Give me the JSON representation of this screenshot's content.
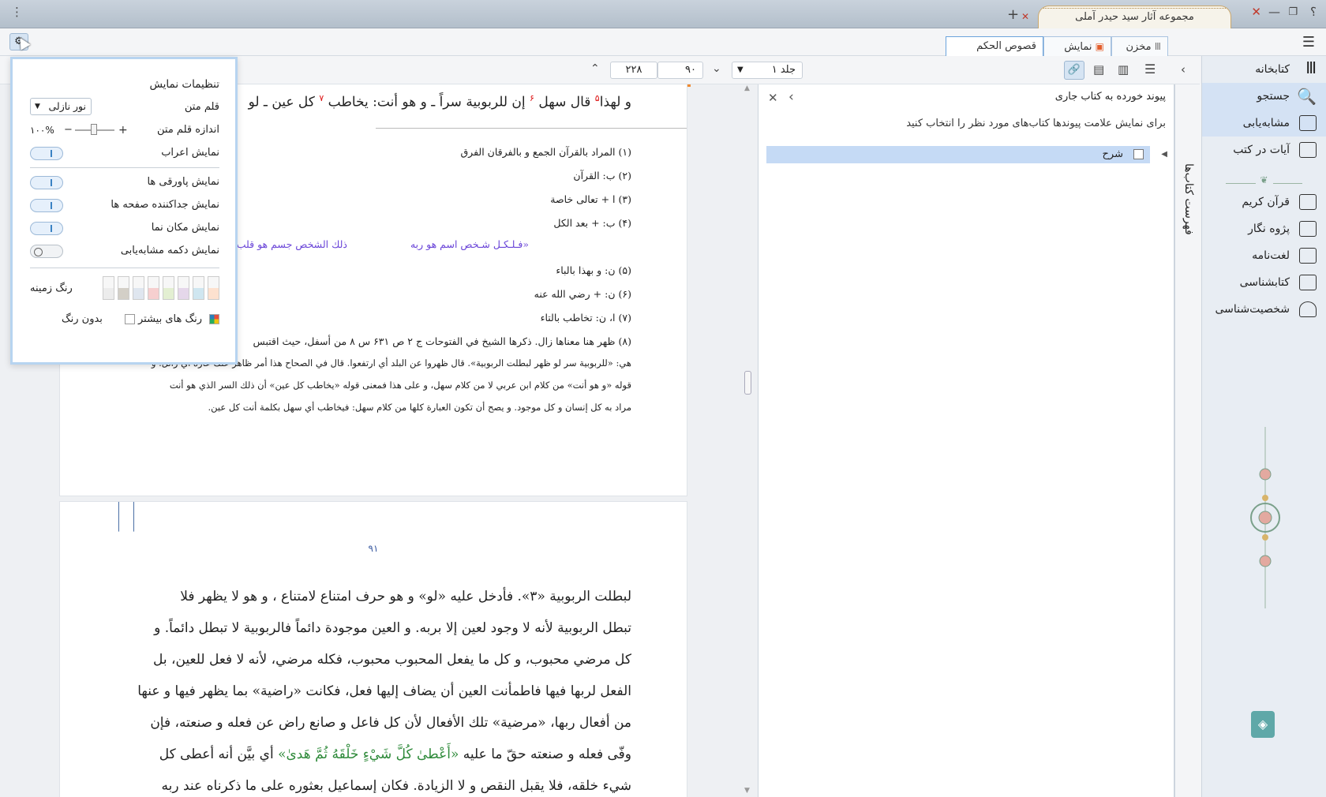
{
  "window": {
    "title": "مجموعه آثار سید حیدر آملی",
    "help": "؟",
    "menu": "⋮",
    "add_tab": "+"
  },
  "doc_tabs": [
    {
      "label": "قصوص الحکم"
    },
    {
      "label": "نمایش"
    },
    {
      "label": "مخزن"
    }
  ],
  "nav": {
    "volume": "جلد ۱",
    "page_current": "۹۰",
    "page_total": "۲۲۸"
  },
  "sidebar": {
    "items": [
      {
        "label": "کتابخانه"
      },
      {
        "label": "جستجو"
      },
      {
        "label": "مشابه‌یابی"
      },
      {
        "label": "آیات در کتب"
      },
      {
        "label": "قرآن کریم"
      },
      {
        "label": "پژوه نگار"
      },
      {
        "label": "لغت‌نامه"
      },
      {
        "label": "کتابشناسی"
      },
      {
        "label": "شخصیت‌شناسی"
      }
    ]
  },
  "vertical_tab": {
    "label": "فهرست کتاب‌ها"
  },
  "link_panel": {
    "title": "پیوند خورده به کتاب جاری",
    "description": "برای نمایش علامت پیوندها کتاب‌های مورد نظر را انتخاب کنید",
    "row_label": "شرح"
  },
  "settings": {
    "title": "تنظیمات نمایش",
    "font_label": "قلم متن",
    "font_value": "نور نازلی",
    "size_label": "اندازه قلم متن",
    "size_value": "۱۰۰%",
    "plus": "+",
    "minus": "−",
    "toggles": [
      {
        "label": "نمایش اعراب",
        "on": true
      },
      {
        "label": "نمایش پاورقی ها",
        "on": true
      },
      {
        "label": "نمایش جداکننده صفحه ها",
        "on": true
      },
      {
        "label": "نمایش مکان نما",
        "on": true
      },
      {
        "label": "نمایش دکمه مشابه‌یابی",
        "on": false
      }
    ],
    "bg_color_label": "رنگ زمینه",
    "more_colors_label": "رنگ های بیشتر",
    "no_color_label": "بدون رنگ",
    "swatches": [
      "#fde1cf",
      "#cfe6f0",
      "#e5d7ea",
      "#e3efd2",
      "#f6cfcf",
      "#dfe6ef",
      "#d3cfc7",
      "#ececec"
    ]
  },
  "page1": {
    "heading": "و لهذا",
    "heading_mid": "قال سهل",
    "heading_mid2": "إن للربوبية سراً ـ و هو أنت: يخاطب",
    "heading_end": "كل عين ـ لو",
    "footnotes": [
      {
        "n": "(۱)",
        "t": "المراد بالقرآن الجمع و بالفرقان الفرق"
      },
      {
        "n": "(۲)",
        "t": "ب: القرآن"
      },
      {
        "n": "(۳)",
        "t": "ا + تعالی خاصة"
      },
      {
        "n": "(۴)",
        "t": "ب: + بعد الكل"
      },
      {
        "n": "(۵)",
        "t": "ن: و بهذا بالباء"
      },
      {
        "n": "(۶)",
        "t": "ن: + رضي الله عنه"
      },
      {
        "n": "(۷)",
        "t": "ا، ن: تخاطب بالتاء"
      },
      {
        "n": "(۸)",
        "t": "ظهر هنا معناها زال. ذكرها الشيخ في الفتوحات ج ۲ ص ۶۳۱ س ۸ من أسفل، حيث اقتبس"
      }
    ],
    "purple_1": "«فـلـكـل شـخص اسم هو ربه",
    "purple_2": "ذلك الشخص جسم هو قلب",
    "long_lines": [
      "هي: «للربوبية سر لو ظهر لبطلت الربوبية». قال ظهروا عن البلد أي ارتفعوا. قال في الصحاح هذا أمر ظاهر عنك عاره أي زائل. و",
      "قوله «و هو أنت» من كلام ابن عربي لا من كلام سهل، و على هذا فمعنى قوله «يخاطب كل عين» أن ذلك السر الذي هو أنت",
      "مراد به كل إنسان و كل موجود. و يصح أن تكون العبارة كلها من كلام سهل: فيخاطب أي سهل بكلمة أنت كل عين."
    ]
  },
  "page2": {
    "page_number": "۹۱",
    "lines": [
      "لبطلت الربوبية «۳». فأدخل عليه «لو» و هو حرف امتناع لامتناع ، و هو لا يظهر فلا",
      "تبطل الربوبية لأنه لا وجود لعين إلا بربه. و العين موجودة دائماً فالربوبية لا تبطل دائماً. و",
      "كل مرضي محبوب، و كل ما يفعل المحبوب محبوب، فكله مرضي، لأنه لا فعل للعين، بل",
      "الفعل لربها فيها فاطمأنت العين أن يضاف إليها فعل، فكانت «راضية» بما يظهر فيها و عنها",
      "من أفعال ربها، «مرضية» تلك الأفعال لأن كل فاعل و صانع راض عن فعله و صنعته، فإن",
      "وفّى فعله و صنعته حقّ ما عليه",
      "أي بيَّن أنه أعطى كل",
      "شيء خلقه، فلا يقبل النقص و لا الزيادة. فكان إسماعيل بعثوره على ما ذكرناه عند ربه"
    ],
    "quran": "«أَعْطىٰ كُلَّ شَيْءٍ خَلْقَهُ ثُمَّ هَدىٰ»"
  }
}
